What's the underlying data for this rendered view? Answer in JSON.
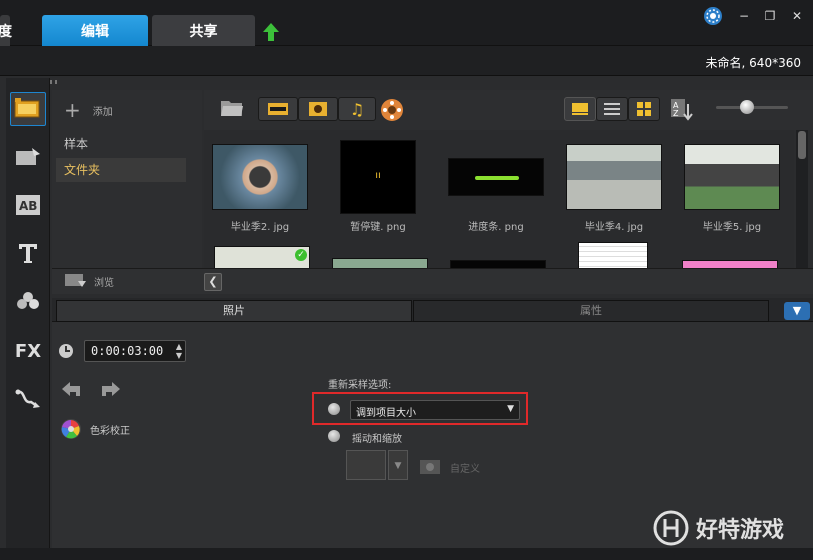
{
  "tabs": {
    "capture": "度",
    "edit": "编辑",
    "share": "共享"
  },
  "window": {
    "minimize": "−",
    "restore": "❐",
    "close": "✕"
  },
  "project_info": "未命名, 640*360",
  "left_tools": [
    "media-icon",
    "transition-icon",
    "title-ab-icon",
    "text-icon",
    "graphics-icon",
    "fx-icon",
    "path-icon"
  ],
  "library": {
    "add_label": "添加",
    "tree": [
      {
        "label": "样本",
        "selected": false
      },
      {
        "label": "文件夹",
        "selected": true
      }
    ],
    "browse_label": "浏览",
    "thumbnails": [
      {
        "name": "毕业季2. jpg",
        "color": "#55626e"
      },
      {
        "name": "暂停键. png",
        "color": "#000000",
        "glyph": "ıı"
      },
      {
        "name": "进度条. png",
        "color": "#050505"
      },
      {
        "name": "毕业季4. jpg",
        "color": "#9aa0a0"
      },
      {
        "name": "毕业季5. jpg",
        "color": "#6f8a78"
      }
    ]
  },
  "options": {
    "tab_photo": "照片",
    "tab_attributes": "属性",
    "duration": "0:00:03:00",
    "color_correction": "色彩校正",
    "resample_label": "重新采样选项:",
    "resample_selected": "调到项目大小",
    "pan_zoom": "摇动和缩放",
    "custom": "自定义"
  },
  "watermark": "好特游戏",
  "colors": {
    "accent": "#1a96dc",
    "highlight": "#e0292a",
    "gold": "#f0c030"
  }
}
